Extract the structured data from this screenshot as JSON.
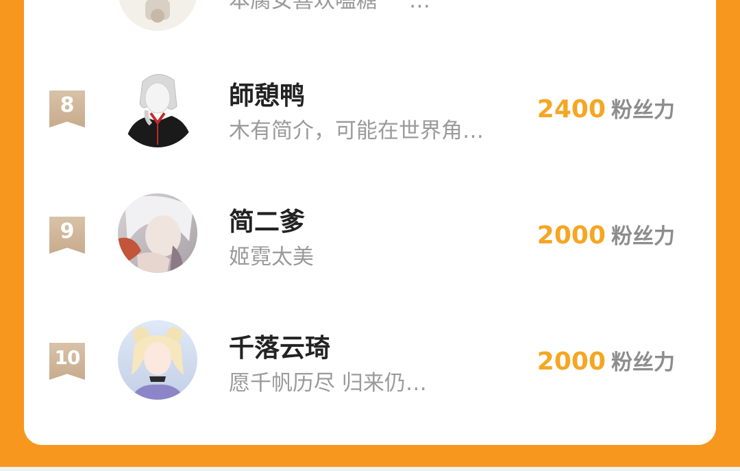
{
  "partial_row": {
    "bio": "本腐女喜欢嗑糖",
    "ellipsis": "…"
  },
  "rows": [
    {
      "rank": "8",
      "name": "師憩鸭",
      "bio": "木有简介，可能在世界角…",
      "score": "2400",
      "unit": "粉丝力",
      "accent": "#f5a623"
    },
    {
      "rank": "9",
      "name": "简二爹",
      "bio": "姬霓太美",
      "score": "2000",
      "unit": "粉丝力",
      "accent": "#f5a623"
    },
    {
      "rank": "10",
      "name": "千落云琦",
      "bio": "愿千帆历尽 归来仍…",
      "score": "2000",
      "unit": "粉丝力",
      "accent": "#f5a623"
    }
  ],
  "colors": {
    "frame": "#f7971e",
    "card": "#ffffff",
    "rank_badge": "#d4bca0",
    "name": "#222222",
    "bio": "#9a9a9a",
    "score": "#f5a623"
  }
}
